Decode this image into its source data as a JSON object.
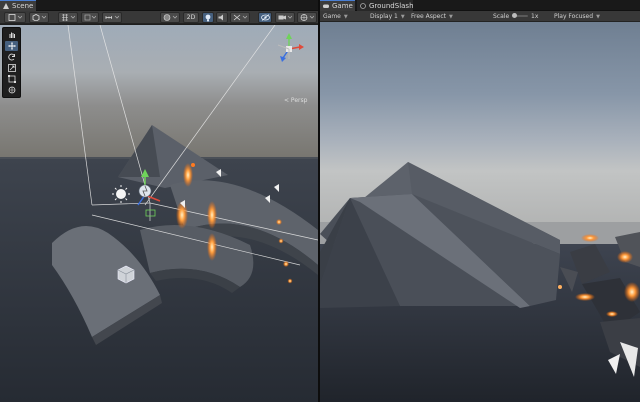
{
  "scene": {
    "tab_label": "Scene",
    "persp_label": "< Persp",
    "toolbar_2d_label": "2D",
    "tools": [
      "hand-tool",
      "move-tool",
      "rotate-tool",
      "scale-tool",
      "rect-tool",
      "transform-tool"
    ],
    "active_tool": "move-tool"
  },
  "game": {
    "tab_label": "Game",
    "tab2_label": "GroundSlash",
    "mode_label": "Game",
    "display_label": "Display 1",
    "aspect_label": "Free Aspect",
    "scale_label": "Scale",
    "scale_value": "1x",
    "play_label": "Play Focused"
  },
  "colors": {
    "editor_bg": "#383838",
    "accent": "#46607f",
    "sky_top": "#7f91a4",
    "ground": "#2f3540",
    "particle": "#ff8c2a"
  }
}
